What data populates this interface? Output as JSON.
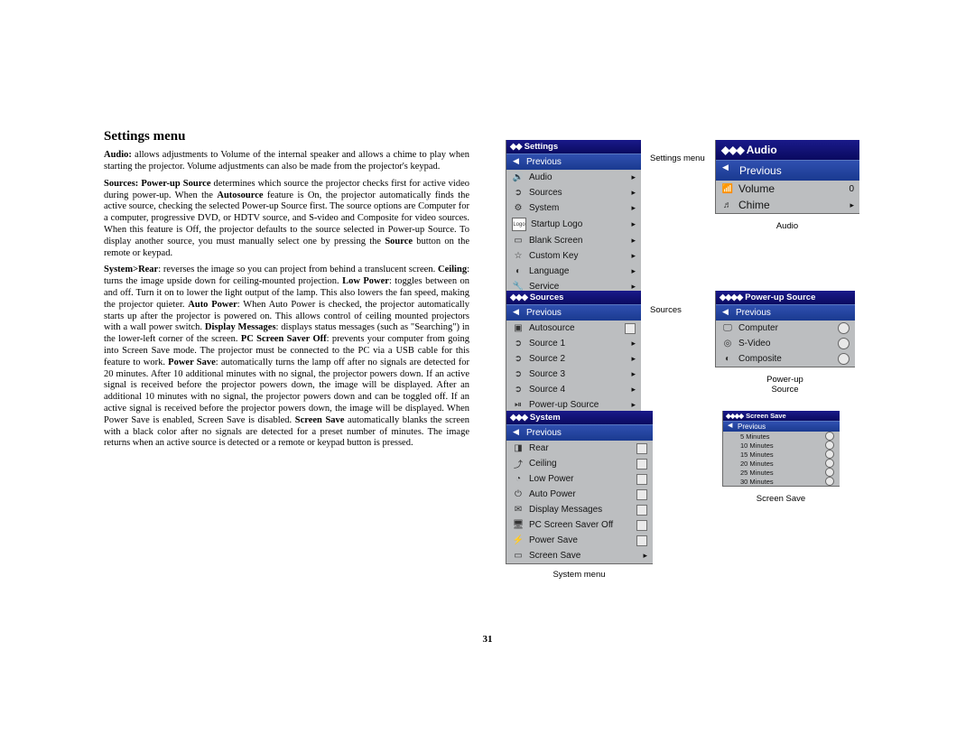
{
  "doc": {
    "heading": "Settings menu",
    "page_number": "31",
    "para_audio_1": "Audio:",
    "para_audio_2": " allows adjustments to Volume of the internal speaker and allows a chime to play when starting the projector. Volume adjustments can also be made from the projector's keypad.",
    "para_sources_1": "Sources: Power-up Source",
    "para_sources_2": " determines which source the projector checks first for active video during power-up. When the ",
    "para_sources_3": "Autosource",
    "para_sources_4": " feature is On, the projector automatically finds the active source, checking the selected Power-up Source first. The source options are Computer for a computer, progressive DVD, or HDTV source, and S-video and Composite for video sources. When this feature is Off, the projector defaults to the source selected in Power-up Source. To display another source, you must manually select one by pressing the ",
    "para_sources_5": "Source",
    "para_sources_6": " button on the remote or keypad.",
    "para_sys_1": "System>Rear",
    "para_sys_2": ": reverses the image so you can project from behind a translucent screen. ",
    "para_sys_3": "Ceiling",
    "para_sys_4": ": turns the image upside down for ceiling-mounted projection. ",
    "para_sys_5": "Low Power",
    "para_sys_6": ": toggles between on and off. Turn it on to lower the light output of the lamp. This also lowers the fan speed, making the projector quieter. ",
    "para_sys_7": "Auto Power",
    "para_sys_8": ": When Auto Power is checked, the projector automatically starts up after the projector is powered on. This allows control of ceiling mounted projectors with a wall power switch. ",
    "para_sys_9": "Display Messages",
    "para_sys_10": ": displays status messages (such as \"Searching\") in the lower-left corner of the screen. ",
    "para_sys_11": "PC Screen Saver Off",
    "para_sys_12": ": prevents your computer from going into Screen Save mode. The projector must be connected to the PC via a USB cable for this feature to work. ",
    "para_sys_13": "Power Save",
    "para_sys_14": ": automatically turns the lamp off after no signals are detected for 20 minutes. After 10 additional minutes with no signal, the projector powers down. If an active signal is received before the projector powers down, the image will be displayed. After an additional 10 minutes with no signal, the projector powers down and can be toggled off. If an active signal is received before the projector powers down, the image will be displayed. When Power Save is enabled, Screen Save is disabled. ",
    "para_sys_15": "Screen Save",
    "para_sys_16": " automatically blanks the screen with a black color after no signals are detected for a preset number of minutes. The image returns when an active source is detected or a remote or keypad button is pressed."
  },
  "captions": {
    "settings": "Settings menu",
    "audio": "Audio",
    "sources": "Sources",
    "powerup": "Power-up Source",
    "powerup1": "Power-up",
    "powerup2": "Source",
    "system": "System menu",
    "screensave": "Screen Save"
  },
  "menus": {
    "settings": {
      "title": "Settings",
      "prev": "Previous",
      "items": [
        {
          "icon": "🔊",
          "label": "Audio"
        },
        {
          "icon": "➲",
          "label": "Sources"
        },
        {
          "icon": "⚙",
          "label": "System"
        },
        {
          "icon": "Logo",
          "label": "Startup Logo"
        },
        {
          "icon": "▭",
          "label": "Blank Screen"
        },
        {
          "icon": "☆",
          "label": "Custom Key"
        },
        {
          "icon": "◐",
          "label": "Language"
        },
        {
          "icon": "🔧",
          "label": "Service"
        }
      ]
    },
    "audio": {
      "title": "Audio",
      "prev": "Previous",
      "items": [
        {
          "icon": "📶",
          "label": "Volume",
          "value": "0"
        },
        {
          "icon": "♬",
          "label": "Chime"
        }
      ]
    },
    "sources": {
      "title": "Sources",
      "prev": "Previous",
      "items": [
        {
          "icon": "▣",
          "label": "Autosource",
          "check": true
        },
        {
          "icon": "➲",
          "label": "Source 1"
        },
        {
          "icon": "➲",
          "label": "Source 2"
        },
        {
          "icon": "➲",
          "label": "Source 3"
        },
        {
          "icon": "➲",
          "label": "Source 4"
        },
        {
          "icon": "⏯",
          "label": "Power-up Source"
        }
      ]
    },
    "powerup": {
      "title": "Power-up Source",
      "prev": "Previous",
      "items": [
        {
          "icon": "🖵",
          "label": "Computer",
          "radio": true
        },
        {
          "icon": "◎",
          "label": "S-Video",
          "radio": true
        },
        {
          "icon": "◐",
          "label": "Composite",
          "radio": true
        }
      ]
    },
    "system": {
      "title": "System",
      "prev": "Previous",
      "items": [
        {
          "icon": "◨",
          "label": "Rear",
          "check": true
        },
        {
          "icon": "⤴",
          "label": "Ceiling",
          "check": true
        },
        {
          "icon": "◔",
          "label": "Low Power",
          "check": true
        },
        {
          "icon": "⏻",
          "label": "Auto Power",
          "check": true
        },
        {
          "icon": "✉",
          "label": "Display Messages",
          "check": true
        },
        {
          "icon": "🖥",
          "label": "PC Screen Saver Off",
          "check": true
        },
        {
          "icon": "⚡",
          "label": "Power Save",
          "check": true
        },
        {
          "icon": "▭",
          "label": "Screen Save"
        }
      ]
    },
    "screensave": {
      "title": "Screen Save",
      "prev": "Previous",
      "items": [
        {
          "label": "5 Minutes"
        },
        {
          "label": "10 Minutes"
        },
        {
          "label": "15 Minutes"
        },
        {
          "label": "20 Minutes"
        },
        {
          "label": "25 Minutes"
        },
        {
          "label": "30 Minutes"
        }
      ]
    }
  }
}
